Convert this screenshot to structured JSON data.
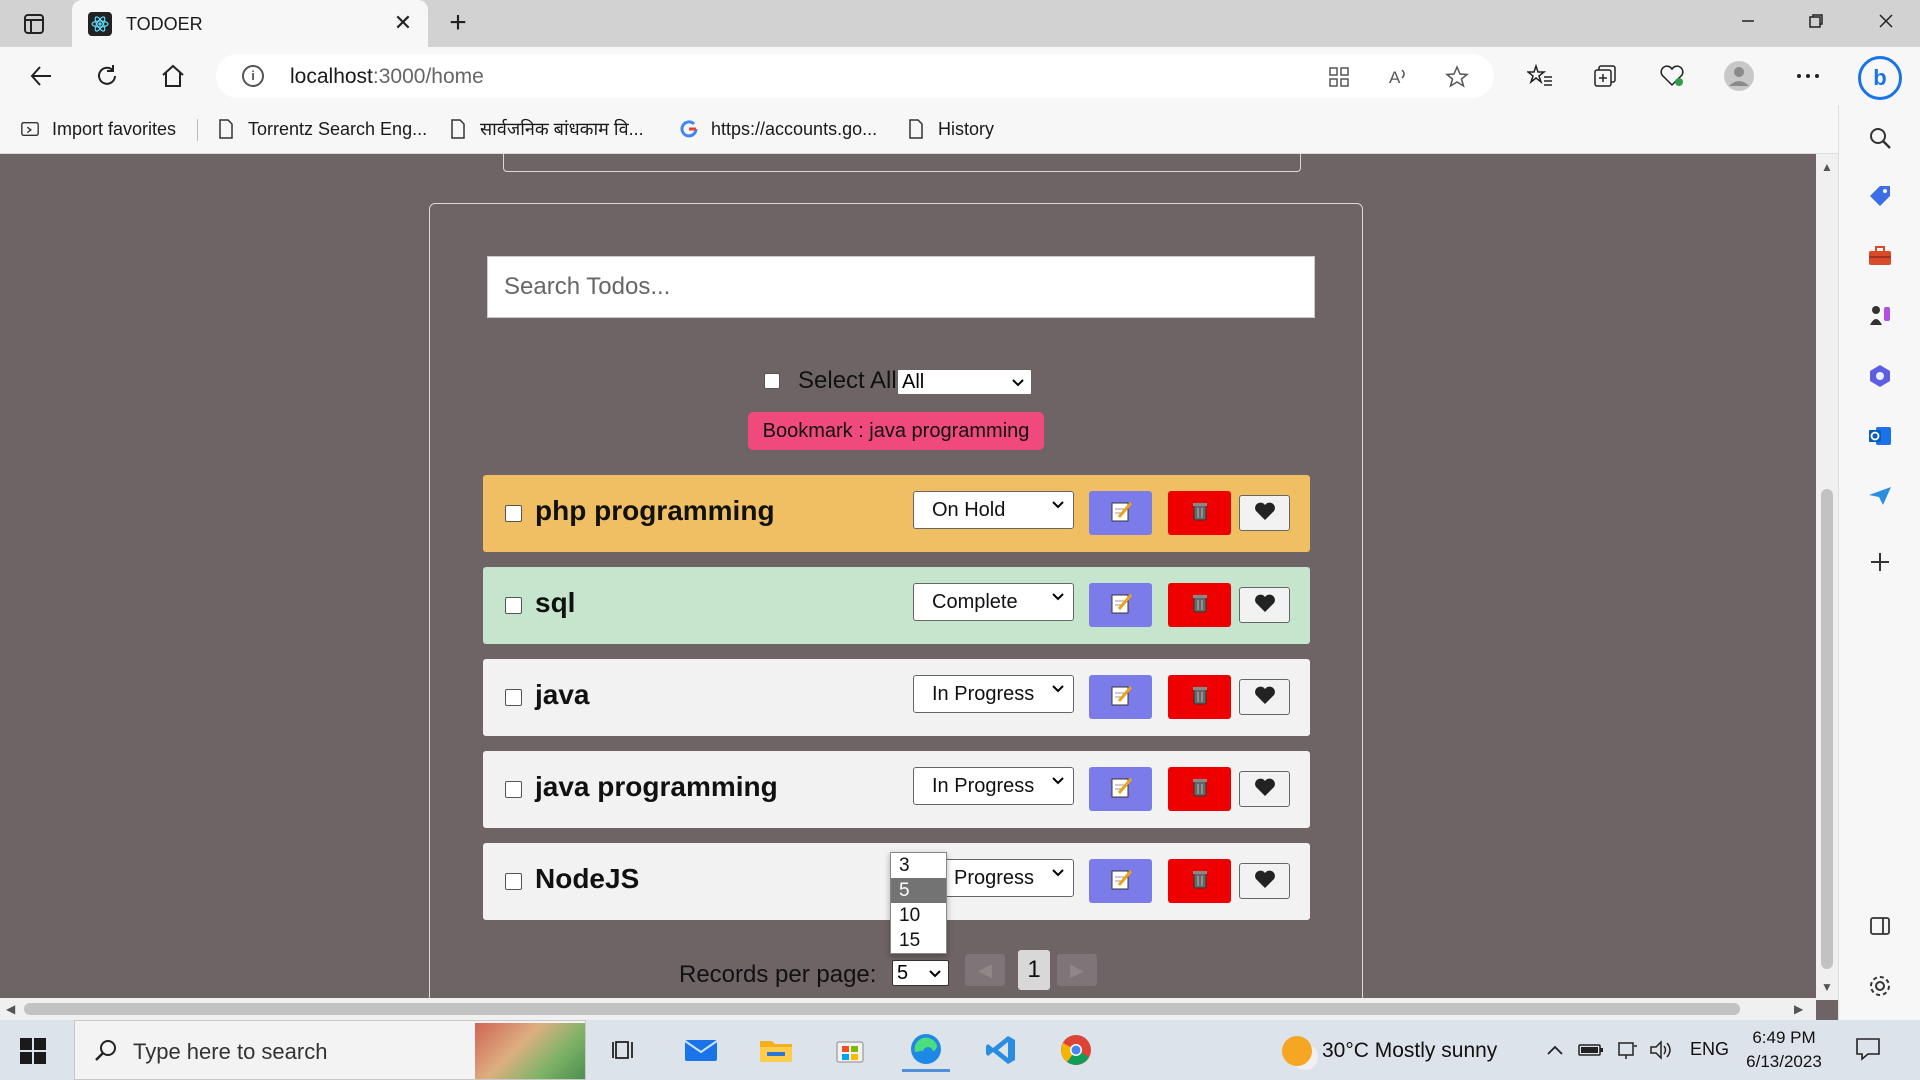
{
  "browser": {
    "tab_title": "TODOER",
    "tab_close": "✕",
    "new_tab": "+",
    "url_host": "localhost",
    "url_path": ":3000/home",
    "favorites": [
      {
        "label": "Import favorites",
        "icon": "import-icon"
      },
      {
        "label": "Torrentz Search Eng...",
        "icon": "page-icon"
      },
      {
        "label": "सार्वजनिक बांधकाम वि...",
        "icon": "page-icon"
      },
      {
        "label": "https://accounts.go...",
        "icon": "google-icon"
      },
      {
        "label": "History",
        "icon": "page-icon"
      }
    ]
  },
  "app": {
    "search_placeholder": "Search Todos...",
    "select_all_label": "Select All",
    "filter_value": "All",
    "bookmark_label": "Bookmark : java programming",
    "todos": [
      {
        "name": "php programming",
        "status": "On Hold",
        "bg": "#f0bf63"
      },
      {
        "name": "sql",
        "status": "Complete",
        "bg": "#c5e5cc"
      },
      {
        "name": "java",
        "status": "In Progress",
        "bg": "#f2f2f2"
      },
      {
        "name": "java programming",
        "status": "In Progress",
        "bg": "#f2f2f2"
      },
      {
        "name": "NodeJS",
        "status": "Progress",
        "bg": "#f2f2f2"
      }
    ],
    "records_label": "Records per page:",
    "records_value": "5",
    "records_options": [
      "3",
      "5",
      "10",
      "15"
    ],
    "records_selected": "5",
    "page_prev": "◀",
    "page_next": "▶",
    "page_current": "1"
  },
  "taskbar": {
    "search_text": "Type here to search",
    "weather_text": "30°C  Mostly sunny",
    "lang": "ENG",
    "time": "6:49 PM",
    "date": "6/13/2023"
  },
  "colors": {
    "page_bg": "#6e6466",
    "edit_button": "#7b7bea",
    "delete_button": "#ef0000",
    "bookmark": "#f0497c"
  }
}
